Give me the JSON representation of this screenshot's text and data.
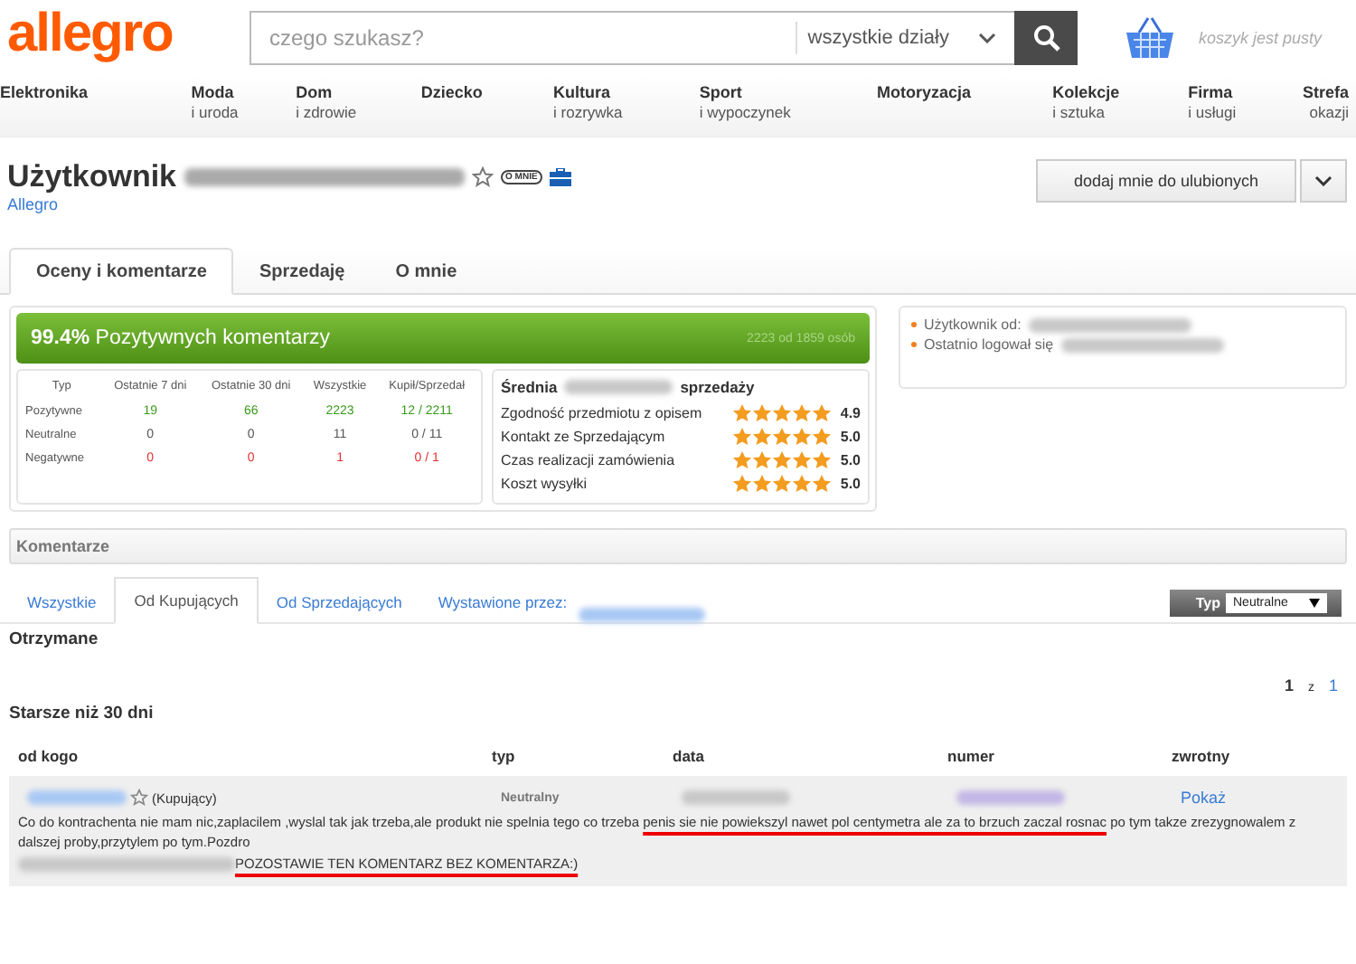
{
  "header": {
    "logo": "allegro",
    "search": {
      "placeholder": "czego szukasz?",
      "category": "wszystkie działy"
    },
    "cart": "koszyk jest pusty"
  },
  "nav": [
    {
      "title": "Elektronika"
    },
    {
      "title": "Moda",
      "sub": "i uroda"
    },
    {
      "title": "Dom",
      "sub": "i zdrowie"
    },
    {
      "title": "Dziecko"
    },
    {
      "title": "Kultura",
      "sub": "i rozrywka"
    },
    {
      "title": "Sport",
      "sub": "i wypoczynek"
    },
    {
      "title": "Motoryzacja"
    },
    {
      "title": "Kolekcje",
      "sub": "i sztuka"
    },
    {
      "title": "Firma",
      "sub": "i usługi"
    },
    {
      "title": "Strefa",
      "sub": "okazji"
    }
  ],
  "user": {
    "title": "Użytkownik",
    "badge": "O MNIE",
    "link": "Allegro",
    "favorite_button": "dodaj mnie do ulubionych"
  },
  "tabs": [
    {
      "label": "Oceny i komentarze",
      "selected": true
    },
    {
      "label": "Sprzedaję",
      "selected": false
    },
    {
      "label": "O mnie",
      "selected": false
    }
  ],
  "summary": {
    "percent": "99.4%",
    "label": "Pozytywnych komentarzy",
    "count": "2223 od 1859 osób"
  },
  "stats": {
    "columns": [
      "Typ",
      "Ostatnie 7 dni",
      "Ostatnie 30 dni",
      "Wszystkie",
      "Kupił/Sprzedał"
    ],
    "rows": [
      {
        "kind": "positive",
        "cells": [
          "Pozytywne",
          "19",
          "66",
          "2223",
          "12 / 2211"
        ]
      },
      {
        "kind": "neutral",
        "cells": [
          "Neutralne",
          "0",
          "0",
          "11",
          "0 / 11"
        ]
      },
      {
        "kind": "negative",
        "cells": [
          "Negatywne",
          "0",
          "0",
          "1",
          "0 / 1"
        ]
      }
    ]
  },
  "ratings": {
    "title_start": "Średnia",
    "title_end": "sprzedaży",
    "items": [
      {
        "label": "Zgodność przedmiotu z opisem",
        "stars": 5,
        "value": "4.9"
      },
      {
        "label": "Kontakt ze Sprzedającym",
        "stars": 5,
        "value": "5.0"
      },
      {
        "label": "Czas realizacji zamówienia",
        "stars": 5,
        "value": "5.0"
      },
      {
        "label": "Koszt wysyłki",
        "stars": 5,
        "value": "5.0"
      }
    ]
  },
  "info": [
    "Użytkownik od:",
    "Ostatnio logował się"
  ],
  "comments": {
    "title": "Komentarze",
    "tabs": [
      {
        "label": "Wszystkie",
        "selected": false
      },
      {
        "label": "Od Kupujących",
        "selected": true
      },
      {
        "label": "Od Sprzedających",
        "selected": false
      },
      {
        "label": "Wystawione przez:",
        "selected": false
      }
    ],
    "filter": {
      "label": "Typ",
      "value": "Neutralne"
    },
    "heading": "Otrzymane",
    "pagination": {
      "current": "1",
      "of": "z",
      "total": "1"
    },
    "section": "Starsze niż 30 dni",
    "columns": [
      "od kogo",
      "typ",
      "data",
      "numer",
      "zwrotny"
    ],
    "entry": {
      "role": "(Kupujący)",
      "type": "Neutralny",
      "action": "Pokaż",
      "text_before": "Co do kontrachenta nie mam nic,zaplacilem ,wyslal tak jak trzeba,ale produkt nie spelnia tego co trzeba ",
      "highlighted": "penis sie nie powiekszyl nawet pol centymetra ale za to brzuch zaczal rosnac",
      "text_after": " po tym takze zrezygnowalem z dalszej proby,przytylem po tym.Pozdro",
      "reply": "POZOSTAWIE TEN KOMENTARZ BEZ KOMENTARZA:)"
    }
  }
}
